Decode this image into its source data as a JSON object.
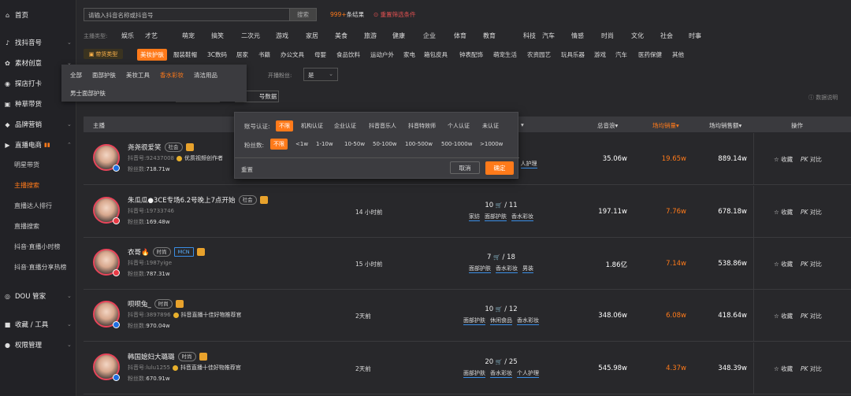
{
  "sidebar": {
    "items": [
      {
        "label": "首页",
        "icon": "home-icon"
      },
      {
        "label": "找抖音号",
        "icon": "tiktok-icon"
      },
      {
        "label": "素材创意",
        "icon": "gear-icon"
      },
      {
        "label": "探店打卡",
        "icon": "location-icon"
      },
      {
        "label": "种草带货",
        "icon": "bag-icon"
      },
      {
        "label": "品牌营销",
        "icon": "diamond-icon"
      },
      {
        "label": "直播电商",
        "icon": "live-icon"
      },
      {
        "label": "DOU 管家",
        "icon": "target-icon"
      },
      {
        "label": "收藏 / 工具",
        "icon": "briefcase-icon"
      },
      {
        "label": "权限管理",
        "icon": "user-icon"
      }
    ],
    "live_subitems": [
      "明星带货",
      "主播搜索",
      "直播达人排行",
      "直播搜索",
      "抖音·直播小时榜",
      "抖音·直播分享热榜"
    ]
  },
  "search": {
    "placeholder": "请输入抖音名称或抖音号",
    "button": "搜索",
    "result_count": "999+",
    "result_suffix": "条结果",
    "reset": "重置筛选条件"
  },
  "anchor_types": {
    "label": "主播类型:",
    "items": [
      "娱乐",
      "才艺",
      "萌宠",
      "搞笑",
      "二次元",
      "游戏",
      "家居",
      "美食",
      "旅游",
      "健康",
      "企业",
      "体育",
      "教育",
      "科技",
      "汽车",
      "情感",
      "时尚",
      "文化",
      "社会",
      "时事"
    ]
  },
  "goods_types": {
    "label": "带货类型",
    "selected": "美妆护肤",
    "items": [
      "美妆护肤",
      "服装鞋帽",
      "3C数码",
      "居家",
      "书籍",
      "办公文具",
      "母婴",
      "食品饮料",
      "运动户外",
      "家电",
      "箱包皮具",
      "钟表配饰",
      "萌宠生活",
      "农资园艺",
      "玩具乐器",
      "游戏",
      "汽车",
      "医药保健",
      "其他"
    ]
  },
  "beauty_subcats": {
    "items": [
      "全部",
      "面部护肤",
      "美妆工具",
      "香水彩妆",
      "清洁用品",
      "男士面部护肤"
    ],
    "selected": "香水彩妆"
  },
  "filters": {
    "live_label": "开播粉丝:",
    "live_value": "是",
    "btn_reset_data": "号数据",
    "data_explain": "数据说明"
  },
  "popover": {
    "cert_label": "账号认证:",
    "cert_options": [
      "不限",
      "机构认证",
      "企业认证",
      "抖音音乐人",
      "抖音特效师",
      "个人认证",
      "未认证"
    ],
    "fans_label": "粉丝数:",
    "fans_options": [
      "不限",
      "<1w",
      "1-10w",
      "10-50w",
      "50-100w",
      "100-500w",
      "500-1000w",
      ">1000w"
    ],
    "reset": "重置",
    "cancel": "取消",
    "confirm": "确定"
  },
  "table": {
    "headers": [
      "主播",
      "总音浪",
      "场均销量",
      "场均销售额",
      "操作"
    ],
    "action_fav": "收藏",
    "action_pk": "对比",
    "rows": [
      {
        "nick": "尧尧很爱笑",
        "tag": "社会",
        "mcn": "",
        "account": "抖音号:92437008",
        "honor": "优质视频创作者",
        "fans_label": "粉丝数:",
        "fans": "718.71w",
        "time": "",
        "goods": "",
        "goods_total": "",
        "tags": [
          "人护理"
        ],
        "total": "35.06w",
        "sales": "19.65w",
        "amount": "889.14w",
        "badge": "blue"
      },
      {
        "nick": "朱瓜瓜●3CE专场6.2号晚上7点开始",
        "tag": "社会",
        "mcn": "",
        "account": "抖音号:19733746",
        "honor": "",
        "fans_label": "粉丝数:",
        "fans": "169.48w",
        "time": "14 小时前",
        "goods": "10",
        "goods_total": "11",
        "tags": [
          "家纺",
          "面部护肤",
          "香水彩妆"
        ],
        "total": "197.11w",
        "sales": "7.76w",
        "amount": "678.18w",
        "badge": "red"
      },
      {
        "nick": "衣哥🔥",
        "tag": "时尚",
        "mcn": "MCN",
        "account": "抖音号:1987yige",
        "honor": "",
        "fans_label": "粉丝数:",
        "fans": "787.31w",
        "time": "15 小时前",
        "goods": "7",
        "goods_total": "18",
        "tags": [
          "面部护肤",
          "香水彩妆",
          "男装"
        ],
        "total": "1.86亿",
        "sales": "7.14w",
        "amount": "538.86w",
        "badge": "red"
      },
      {
        "nick": "呗呗兔_",
        "tag": "时尚",
        "mcn": "",
        "account": "抖音号:3897896",
        "honor": "抖音直播十佳好物推荐官",
        "fans_label": "粉丝数:",
        "fans": "970.04w",
        "time": "2天前",
        "goods": "10",
        "goods_total": "12",
        "tags": [
          "面部护肤",
          "休闲食品",
          "香水彩妆"
        ],
        "total": "348.06w",
        "sales": "6.08w",
        "amount": "418.64w",
        "badge": "blue"
      },
      {
        "nick": "韩国媳妇大璐璐",
        "tag": "时尚",
        "mcn": "",
        "account": "抖音号:lulu1255",
        "honor": "抖音直播十佳好物推荐官",
        "fans_label": "粉丝数:",
        "fans": "670.91w",
        "time": "2天前",
        "goods": "20",
        "goods_total": "25",
        "tags": [
          "面部护肤",
          "香水彩妆",
          "个人护理"
        ],
        "total": "545.98w",
        "sales": "4.37w",
        "amount": "348.39w",
        "badge": "blue"
      }
    ]
  },
  "colors": {
    "accent": "#ff7a1a",
    "background": "#28282b",
    "sidebar": "#222226",
    "link": "#3a8ee6"
  }
}
